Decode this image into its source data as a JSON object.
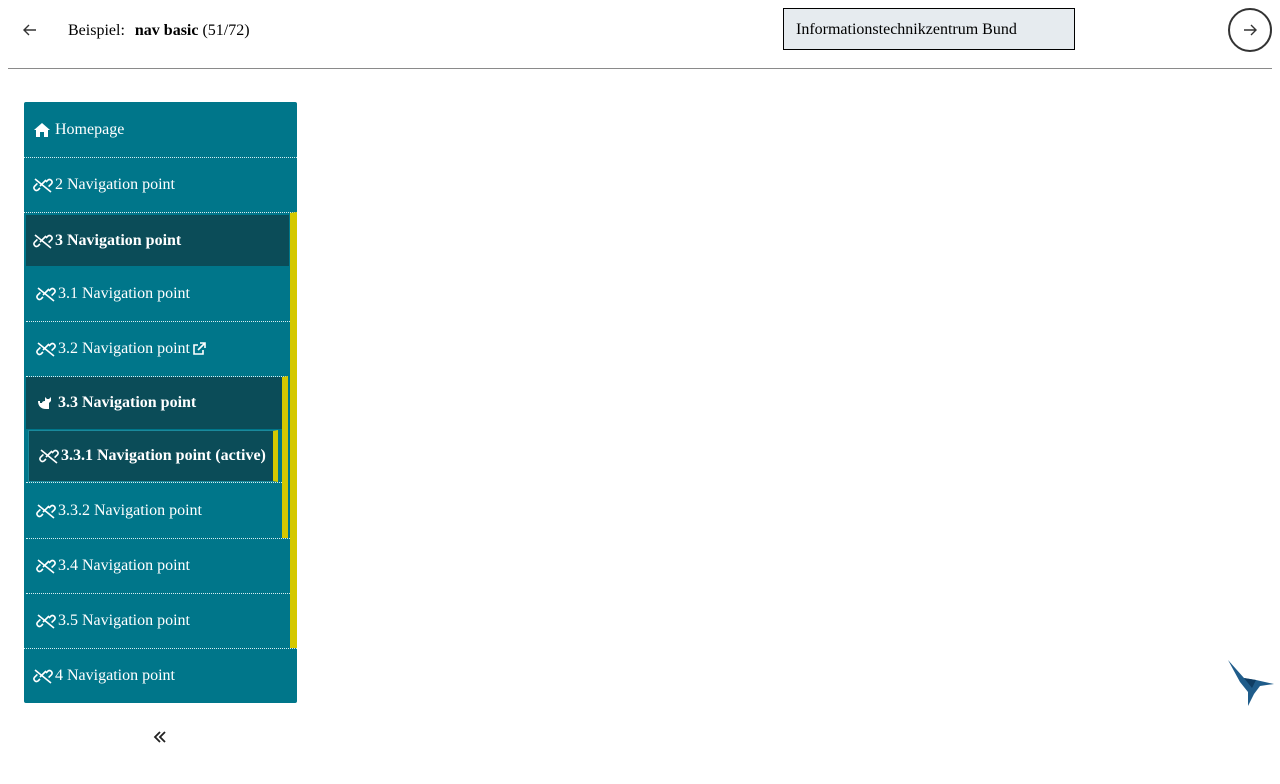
{
  "header": {
    "back_icon": "arrow-left-icon",
    "prefix": "Beispiel:",
    "example_name": "nav basic",
    "counter": "(51/72)",
    "theme_value": "Informationstechnikzentrum Bund",
    "next_icon": "arrow-right-icon"
  },
  "nav": {
    "homepage": "Homepage",
    "nav2": "2 Navigation point",
    "nav3": "3 Navigation point",
    "nav31": "3.1 Navigation point",
    "nav32": "3.2 Navigation point",
    "nav33": "3.3 Navigation point",
    "nav331": "3.3.1 Navigation point (active)",
    "nav332": "3.3.2 Navigation point",
    "nav34": "3.4 Navigation point",
    "nav35": "3.5 Navigation point",
    "nav4": "4 Navigation point",
    "collapse_icon": "chevrons-left-icon"
  },
  "colors": {
    "nav_bg": "#00768a",
    "nav_expanded": "#0b4c58",
    "accent": "#d4c800",
    "select_bg": "#e6ebef"
  }
}
